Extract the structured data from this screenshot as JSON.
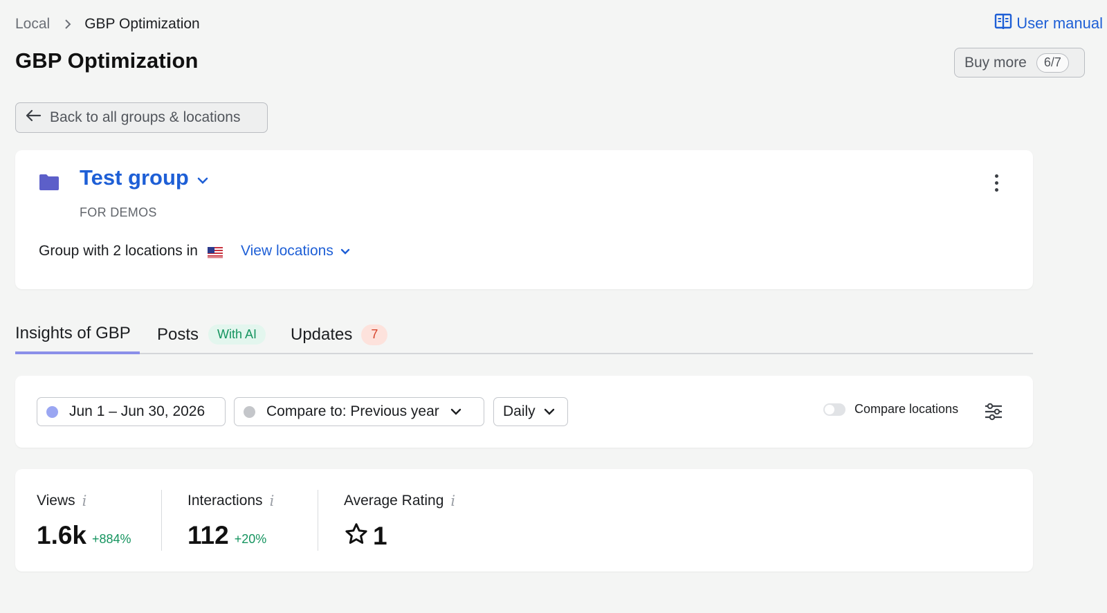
{
  "breadcrumb": {
    "parent": "Local",
    "current": "GBP Optimization"
  },
  "header": {
    "manual_label": "User manual",
    "title": "GBP Optimization",
    "buy_more_label": "Buy more",
    "quota": "6/7"
  },
  "back_button": {
    "label": "Back to all groups & locations"
  },
  "group": {
    "name": "Test group",
    "subtitle": "FOR DEMOS",
    "description": "Group with 2 locations in",
    "view_locations_label": "View locations"
  },
  "tabs": [
    {
      "label": "Insights of GBP",
      "active": true
    },
    {
      "label": "Posts",
      "badge": "With AI"
    },
    {
      "label": "Updates",
      "badge": "7"
    }
  ],
  "filters": {
    "date_range": "Jun 1 – Jun 30, 2026",
    "compare": "Compare to: Previous year",
    "granularity": "Daily",
    "compare_locations_label": "Compare locations",
    "compare_locations_on": false
  },
  "metrics": [
    {
      "label": "Views",
      "value": "1.6k",
      "delta": "+884%"
    },
    {
      "label": "Interactions",
      "value": "112",
      "delta": "+20%"
    },
    {
      "label": "Average Rating",
      "value": "1"
    }
  ],
  "colors": {
    "accent": "#1e5fd6",
    "tab_indicator": "#8a8fe9",
    "date_dot": "#9aa6f2",
    "compare_dot": "#c4c6ca",
    "positive": "#15945f",
    "folder": "#5c5fc9"
  },
  "icons": {
    "breadcrumb_separator": "chevron-right-icon",
    "manual": "book-icon",
    "back": "arrow-left-icon",
    "group": "folder-icon",
    "menu": "kebab-icon",
    "flag": "us-flag-icon",
    "settings": "sliders-icon",
    "rating": "star-icon",
    "info": "info-icon"
  }
}
